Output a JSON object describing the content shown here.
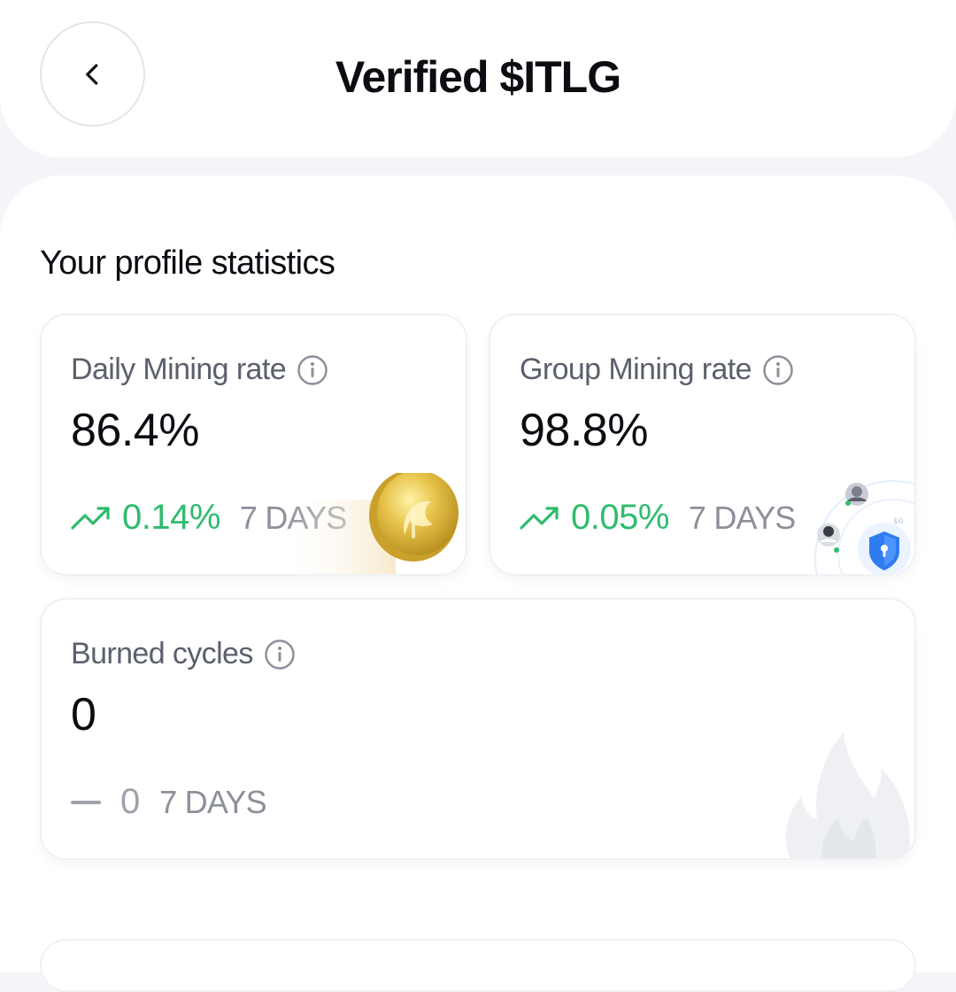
{
  "header": {
    "title": "Verified $ITLG",
    "back_icon": "chevron-left-icon"
  },
  "stats": {
    "section_title": "Your profile statistics",
    "daily": {
      "label": "Daily Mining rate",
      "value": "86.4%",
      "trend_value": "0.14%",
      "trend_days": "7 DAYS",
      "trend_direction": "up"
    },
    "group": {
      "label": "Group Mining rate",
      "value": "98.8%",
      "trend_value": "0.05%",
      "trend_days": "7 DAYS",
      "trend_direction": "up"
    },
    "burned": {
      "label": "Burned cycles",
      "value": "0",
      "trend_value": "0",
      "trend_days": "7 DAYS",
      "trend_direction": "flat"
    }
  },
  "colors": {
    "positive": "#2fbc6d",
    "muted": "#8c909a",
    "text": "#0c0d12",
    "background": "#f4f5f9"
  }
}
